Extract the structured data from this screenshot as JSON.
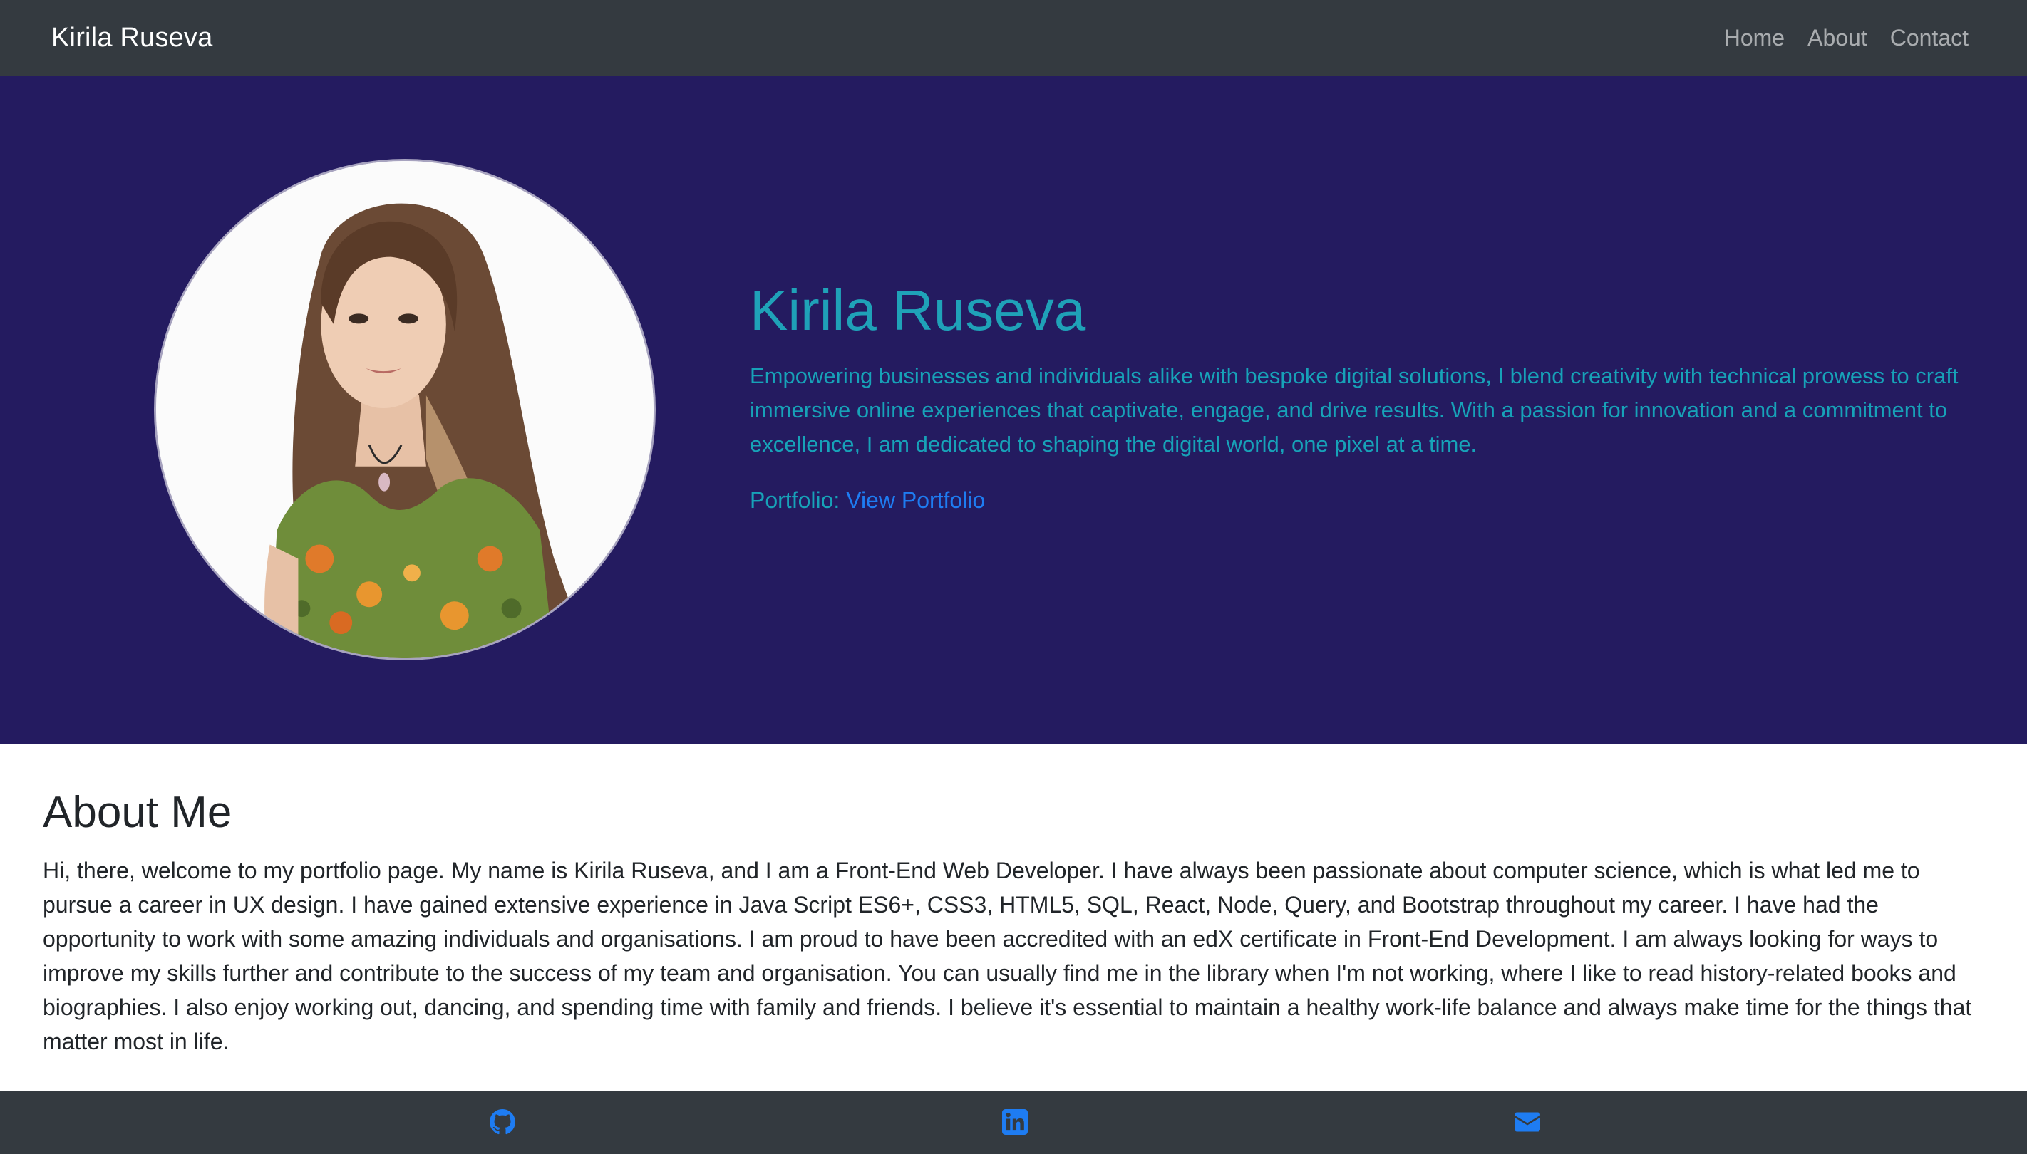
{
  "navbar": {
    "brand": "Kirila Ruseva",
    "links": [
      {
        "label": "Home"
      },
      {
        "label": "About"
      },
      {
        "label": "Contact"
      }
    ]
  },
  "hero": {
    "title": "Kirila Ruseva",
    "lead": "Empowering businesses and individuals alike with bespoke digital solutions, I blend creativity with technical prowess to craft immersive online experiences that captivate, engage, and drive results. With a passion for innovation and a commitment to excellence, I am dedicated to shaping the digital world, one pixel at a time.",
    "portfolio_label": "Portfolio:",
    "portfolio_link": "View Portfolio"
  },
  "about": {
    "heading": "About Me",
    "body": "Hi, there, welcome to my portfolio page. My name is Kirila Ruseva, and I am a Front-End Web Developer. I have always been passionate about computer science, which is what led me to pursue a career in UX design. I have gained extensive experience in Java Script ES6+, CSS3, HTML5, SQL, React, Node, Query, and Bootstrap throughout my career. I have had the opportunity to work with some amazing individuals and organisations. I am proud to have been accredited with an edX certificate in Front-End Development. I am always looking for ways to improve my skills further and contribute to the success of my team and organisation. You can usually find me in the library when I'm not working, where I like to read history-related books and biographies. I also enjoy working out, dancing, and spending time with family and friends. I believe it's essential to maintain a healthy work-life balance and always make time for the things that matter most in life."
  },
  "footer": {
    "icons": [
      "github-icon",
      "linkedin-icon",
      "envelope-icon"
    ]
  },
  "colors": {
    "navbar_bg": "#343a40",
    "hero_bg": "#241b60",
    "accent_teal": "#17a2b8",
    "link_blue": "#1e7cf2",
    "footer_bg": "#343a40"
  }
}
